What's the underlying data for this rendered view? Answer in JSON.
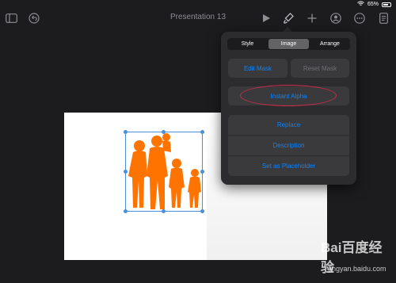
{
  "status_bar": {
    "battery_percent": "65%"
  },
  "toolbar": {
    "title": "Presentation 13",
    "left_icons": [
      "sidebar-icon",
      "undo-icon"
    ],
    "right_icons": [
      "play-icon",
      "paintbrush-icon",
      "plus-icon",
      "collaborate-icon",
      "more-icon",
      "document-icon"
    ]
  },
  "popover": {
    "tabs": [
      {
        "label": "Style",
        "active": false
      },
      {
        "label": "Image",
        "active": true
      },
      {
        "label": "Arrange",
        "active": false
      }
    ],
    "edit_mask_label": "Edit Mask",
    "reset_mask_label": "Reset Mask",
    "instant_alpha_label": "Instant Alpha",
    "actions": [
      {
        "label": "Replace"
      },
      {
        "label": "Description"
      },
      {
        "label": "Set as Placeholder"
      }
    ]
  },
  "image": {
    "fill_color": "#ff7300"
  },
  "watermark": {
    "main": "Bai百度经验",
    "sub": "jingyan.baidu.com"
  }
}
